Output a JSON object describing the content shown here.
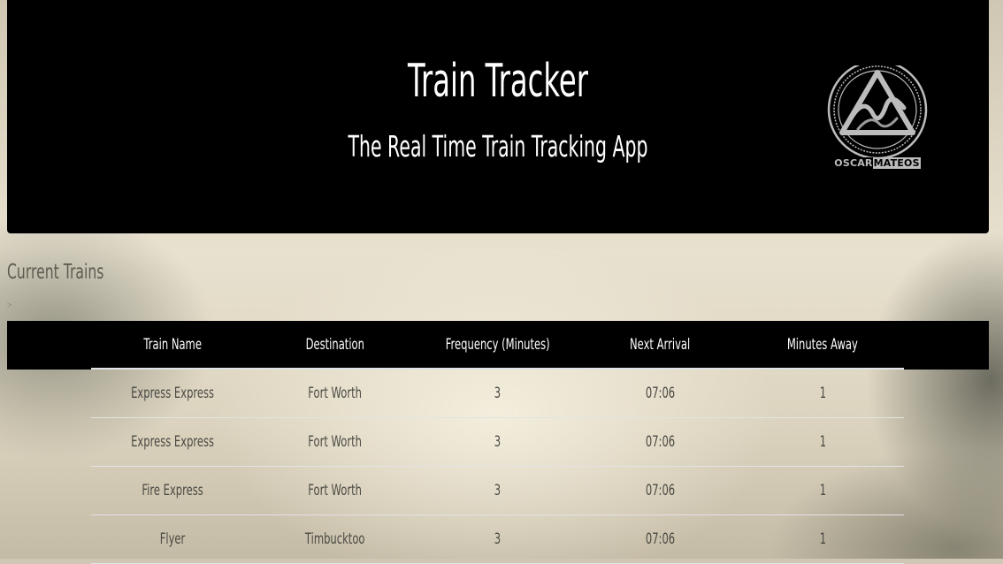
{
  "header": {
    "title": "Train Tracker",
    "subtitle": "The Real Time Train Tracking App",
    "logo": {
      "text_left": "OSCAR",
      "text_boxed": "MATEOS"
    }
  },
  "main": {
    "section_title": "Current Trains",
    "marker": ">",
    "table": {
      "headers": [
        "Train Name",
        "Destination",
        "Frequency (Minutes)",
        "Next Arrival",
        "Minutes Away"
      ],
      "rows": [
        [
          "Express Express",
          "Fort Worth",
          "3",
          "07:06",
          "1"
        ],
        [
          "Express Express",
          "Fort Worth",
          "3",
          "07:06",
          "1"
        ],
        [
          "Fire Express",
          "Fort Worth",
          "3",
          "07:06",
          "1"
        ],
        [
          "Flyer",
          "Timbucktoo",
          "3",
          "07:06",
          "1"
        ]
      ]
    }
  },
  "colors": {
    "header_bg": "#000000",
    "header_text": "#ffffff",
    "table_text": "#4a4a44",
    "section_title": "#5d5a50"
  }
}
